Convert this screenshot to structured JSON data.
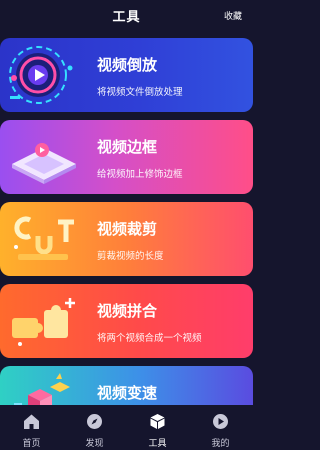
{
  "header": {
    "title": "工具",
    "favorites": "收藏"
  },
  "cards": [
    {
      "title": "视频倒放",
      "subtitle": "将视频文件倒放处理"
    },
    {
      "title": "视频边框",
      "subtitle": "给视频加上修饰边框"
    },
    {
      "title": "视频裁剪",
      "subtitle": "剪裁视频的长度"
    },
    {
      "title": "视频拼合",
      "subtitle": "将两个视频合成一个视频"
    },
    {
      "title": "视频变速",
      "subtitle": ""
    }
  ],
  "tabs": [
    {
      "label": "首页",
      "icon": "home-icon"
    },
    {
      "label": "发现",
      "icon": "compass-icon"
    },
    {
      "label": "工具",
      "icon": "cube-icon",
      "active": true
    },
    {
      "label": "我的",
      "icon": "play-circle-icon"
    }
  ],
  "colors": {
    "background": "#15152d",
    "card_blue": "#2f3fd6",
    "card_pink": "#ff4e88",
    "card_orange": "#ff7f3a",
    "card_red": "#ff4a4a",
    "card_teal": "#2fd0c4"
  }
}
